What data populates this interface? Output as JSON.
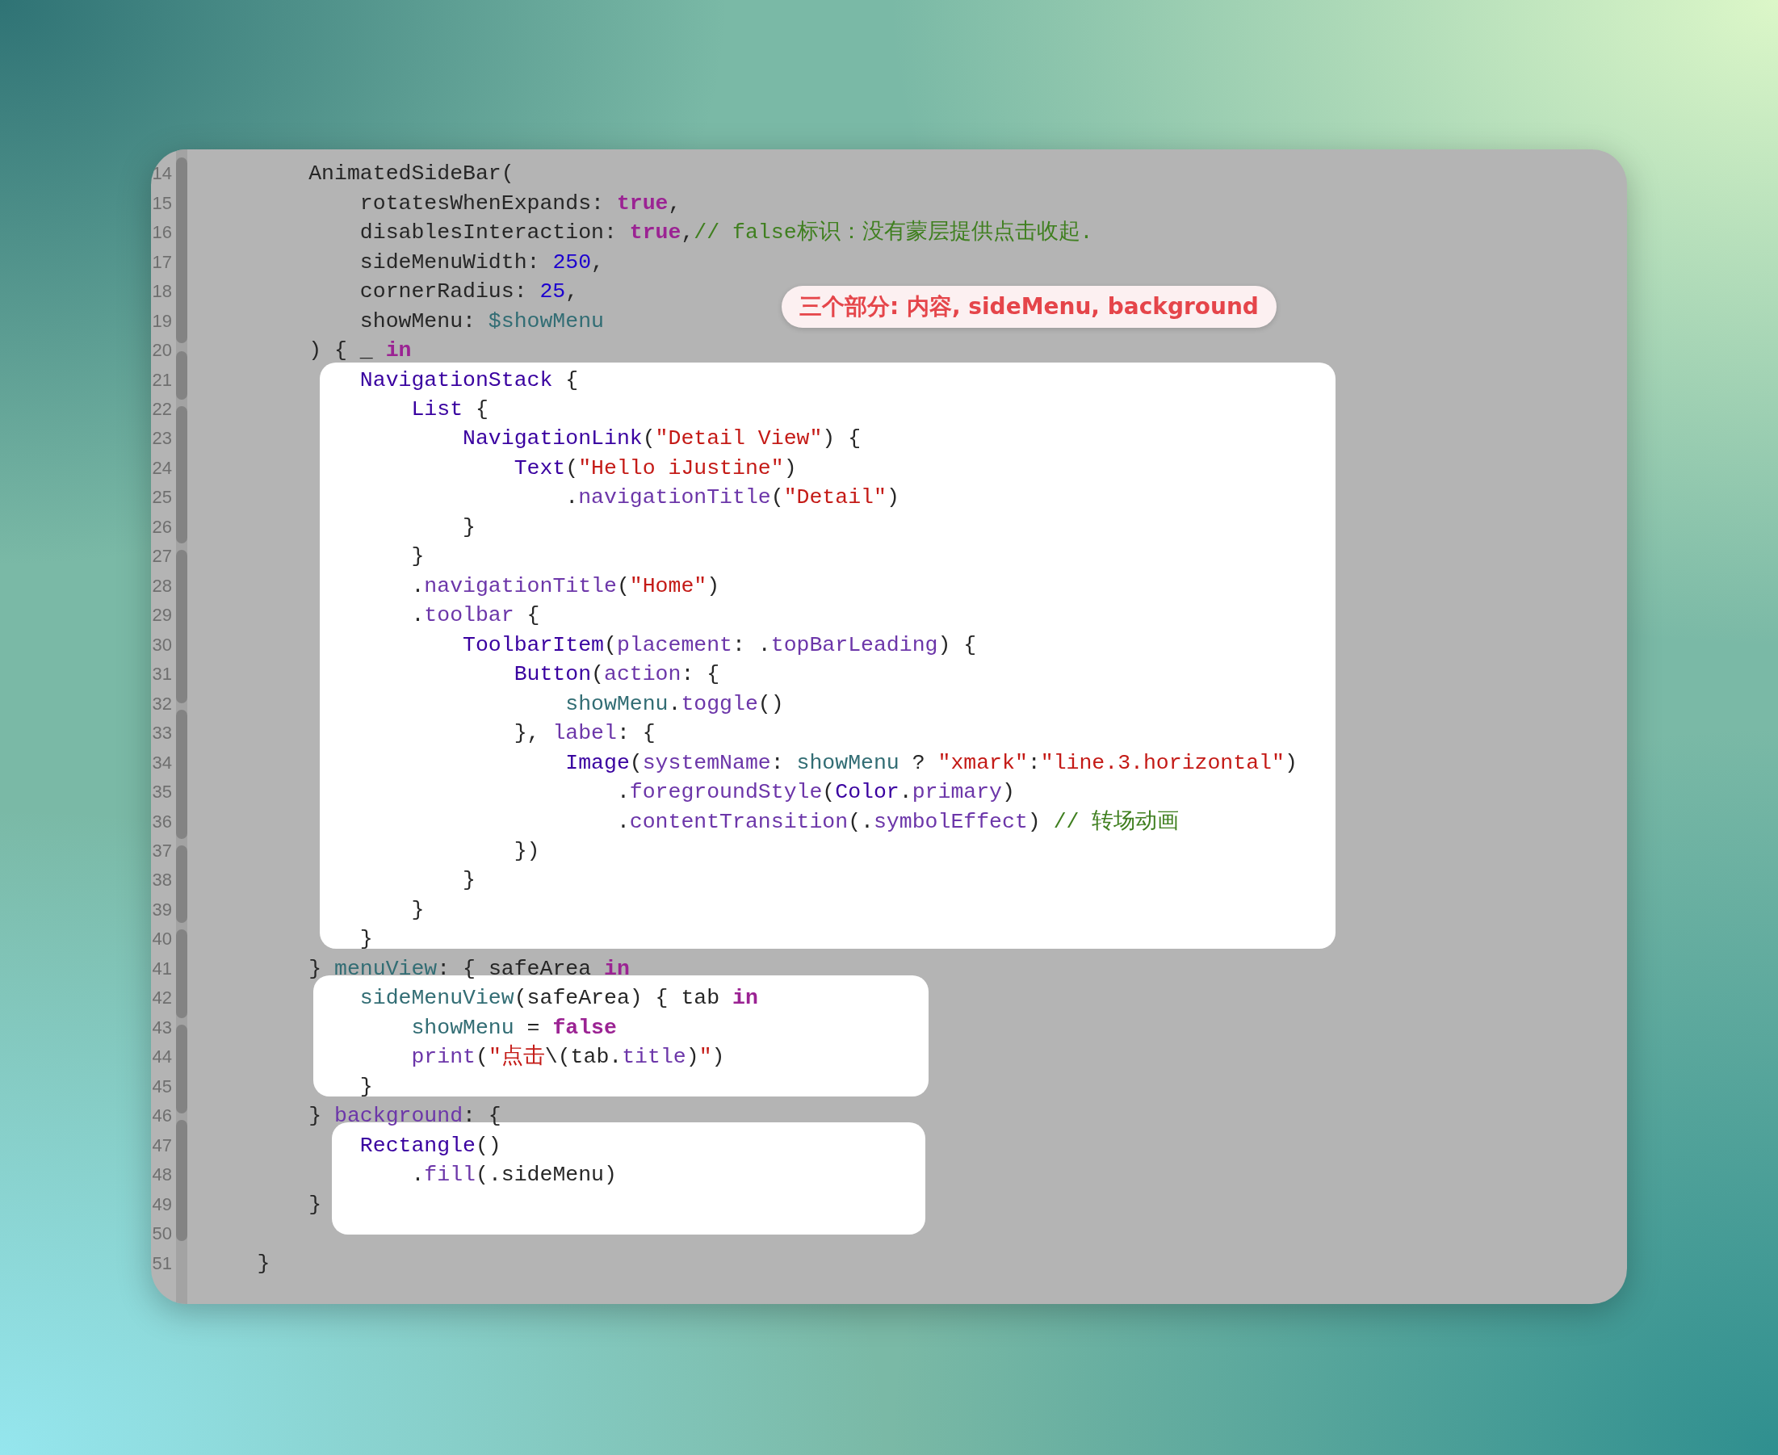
{
  "annotation": {
    "text": "三个部分: 内容, sideMenu, background"
  },
  "lines": [
    {
      "number": "14",
      "tokens": [
        {
          "kind": "plain",
          "text": "        AnimatedSideBar("
        }
      ]
    },
    {
      "number": "15",
      "tokens": [
        {
          "kind": "plain",
          "text": "            rotatesWhenExpands: "
        },
        {
          "kind": "keyword",
          "text": "true"
        },
        {
          "kind": "plain",
          "text": ","
        }
      ]
    },
    {
      "number": "16",
      "tokens": [
        {
          "kind": "plain",
          "text": "            disablesInteraction: "
        },
        {
          "kind": "keyword",
          "text": "true"
        },
        {
          "kind": "plain",
          "text": ","
        },
        {
          "kind": "comment",
          "text": "// false标识：没有蒙层提供点击收起."
        }
      ]
    },
    {
      "number": "17",
      "tokens": [
        {
          "kind": "plain",
          "text": "            sideMenuWidth: "
        },
        {
          "kind": "number",
          "text": "250"
        },
        {
          "kind": "plain",
          "text": ","
        }
      ]
    },
    {
      "number": "18",
      "tokens": [
        {
          "kind": "plain",
          "text": "            cornerRadius: "
        },
        {
          "kind": "number",
          "text": "25"
        },
        {
          "kind": "plain",
          "text": ","
        }
      ]
    },
    {
      "number": "19",
      "tokens": [
        {
          "kind": "plain",
          "text": "            showMenu: "
        },
        {
          "kind": "variable",
          "text": "$showMenu"
        }
      ]
    },
    {
      "number": "20",
      "tokens": [
        {
          "kind": "plain",
          "text": "        ) { _ "
        },
        {
          "kind": "keyword",
          "text": "in"
        }
      ]
    },
    {
      "number": "21",
      "tokens": [
        {
          "kind": "type",
          "text": "            NavigationStack"
        },
        {
          "kind": "plain",
          "text": " {"
        }
      ]
    },
    {
      "number": "22",
      "tokens": [
        {
          "kind": "type",
          "text": "                List"
        },
        {
          "kind": "plain",
          "text": " {"
        }
      ]
    },
    {
      "number": "23",
      "tokens": [
        {
          "kind": "type",
          "text": "                    NavigationLink"
        },
        {
          "kind": "plain",
          "text": "("
        },
        {
          "kind": "string",
          "text": "\"Detail View\""
        },
        {
          "kind": "plain",
          "text": ") {"
        }
      ]
    },
    {
      "number": "24",
      "tokens": [
        {
          "kind": "type",
          "text": "                        Text"
        },
        {
          "kind": "plain",
          "text": "("
        },
        {
          "kind": "string",
          "text": "\"Hello iJustine\""
        },
        {
          "kind": "plain",
          "text": ")"
        }
      ]
    },
    {
      "number": "25",
      "tokens": [
        {
          "kind": "plain",
          "text": "                            ."
        },
        {
          "kind": "method",
          "text": "navigationTitle"
        },
        {
          "kind": "plain",
          "text": "("
        },
        {
          "kind": "string",
          "text": "\"Detail\""
        },
        {
          "kind": "plain",
          "text": ")"
        }
      ]
    },
    {
      "number": "26",
      "tokens": [
        {
          "kind": "plain",
          "text": "                    }"
        }
      ]
    },
    {
      "number": "27",
      "tokens": [
        {
          "kind": "plain",
          "text": "                }"
        }
      ]
    },
    {
      "number": "28",
      "tokens": [
        {
          "kind": "plain",
          "text": "                ."
        },
        {
          "kind": "method",
          "text": "navigationTitle"
        },
        {
          "kind": "plain",
          "text": "("
        },
        {
          "kind": "string",
          "text": "\"Home\""
        },
        {
          "kind": "plain",
          "text": ")"
        }
      ]
    },
    {
      "number": "29",
      "tokens": [
        {
          "kind": "plain",
          "text": "                ."
        },
        {
          "kind": "method",
          "text": "toolbar"
        },
        {
          "kind": "plain",
          "text": " {"
        }
      ]
    },
    {
      "number": "30",
      "tokens": [
        {
          "kind": "type",
          "text": "                    ToolbarItem"
        },
        {
          "kind": "plain",
          "text": "("
        },
        {
          "kind": "method",
          "text": "placement"
        },
        {
          "kind": "plain",
          "text": ": ."
        },
        {
          "kind": "method",
          "text": "topBarLeading"
        },
        {
          "kind": "plain",
          "text": ") {"
        }
      ]
    },
    {
      "number": "31",
      "tokens": [
        {
          "kind": "type",
          "text": "                        Button"
        },
        {
          "kind": "plain",
          "text": "("
        },
        {
          "kind": "method",
          "text": "action"
        },
        {
          "kind": "plain",
          "text": ": {"
        }
      ]
    },
    {
      "number": "32",
      "tokens": [
        {
          "kind": "variable",
          "text": "                            showMenu"
        },
        {
          "kind": "plain",
          "text": "."
        },
        {
          "kind": "method",
          "text": "toggle"
        },
        {
          "kind": "plain",
          "text": "()"
        }
      ]
    },
    {
      "number": "33",
      "tokens": [
        {
          "kind": "plain",
          "text": "                        }, "
        },
        {
          "kind": "method",
          "text": "label"
        },
        {
          "kind": "plain",
          "text": ": {"
        }
      ]
    },
    {
      "number": "34",
      "tokens": [
        {
          "kind": "type",
          "text": "                            Image"
        },
        {
          "kind": "plain",
          "text": "("
        },
        {
          "kind": "method",
          "text": "systemName"
        },
        {
          "kind": "plain",
          "text": ": "
        },
        {
          "kind": "variable",
          "text": "showMenu"
        },
        {
          "kind": "plain",
          "text": " ? "
        },
        {
          "kind": "string",
          "text": "\"xmark\""
        },
        {
          "kind": "plain",
          "text": ":"
        },
        {
          "kind": "string",
          "text": "\"line.3.horizontal\""
        },
        {
          "kind": "plain",
          "text": ")"
        }
      ]
    },
    {
      "number": "35",
      "tokens": [
        {
          "kind": "plain",
          "text": "                                ."
        },
        {
          "kind": "method",
          "text": "foregroundStyle"
        },
        {
          "kind": "plain",
          "text": "("
        },
        {
          "kind": "type",
          "text": "Color"
        },
        {
          "kind": "plain",
          "text": "."
        },
        {
          "kind": "method",
          "text": "primary"
        },
        {
          "kind": "plain",
          "text": ")"
        }
      ]
    },
    {
      "number": "36",
      "tokens": [
        {
          "kind": "plain",
          "text": "                                ."
        },
        {
          "kind": "method",
          "text": "contentTransition"
        },
        {
          "kind": "plain",
          "text": "(."
        },
        {
          "kind": "method",
          "text": "symbolEffect"
        },
        {
          "kind": "plain",
          "text": ") "
        },
        {
          "kind": "comment",
          "text": "// 转场动画"
        }
      ]
    },
    {
      "number": "37",
      "tokens": [
        {
          "kind": "plain",
          "text": "                        })"
        }
      ]
    },
    {
      "number": "38",
      "tokens": [
        {
          "kind": "plain",
          "text": "                    }"
        }
      ]
    },
    {
      "number": "39",
      "tokens": [
        {
          "kind": "plain",
          "text": "                }"
        }
      ]
    },
    {
      "number": "40",
      "tokens": [
        {
          "kind": "plain",
          "text": "            }"
        }
      ]
    },
    {
      "number": "41",
      "tokens": [
        {
          "kind": "plain",
          "text": "        } "
        },
        {
          "kind": "variable",
          "text": "menuView"
        },
        {
          "kind": "plain",
          "text": ": { safeArea "
        },
        {
          "kind": "keyword",
          "text": "in"
        }
      ]
    },
    {
      "number": "42",
      "tokens": [
        {
          "kind": "variable",
          "text": "            sideMenuView"
        },
        {
          "kind": "plain",
          "text": "(safeArea) { tab "
        },
        {
          "kind": "keyword",
          "text": "in"
        }
      ]
    },
    {
      "number": "43",
      "tokens": [
        {
          "kind": "variable",
          "text": "                showMenu"
        },
        {
          "kind": "plain",
          "text": " = "
        },
        {
          "kind": "keyword",
          "text": "false"
        }
      ]
    },
    {
      "number": "44",
      "tokens": [
        {
          "kind": "method",
          "text": "                print"
        },
        {
          "kind": "plain",
          "text": "("
        },
        {
          "kind": "string",
          "text": "\"点击"
        },
        {
          "kind": "plain",
          "text": "\\(tab."
        },
        {
          "kind": "method",
          "text": "title"
        },
        {
          "kind": "plain",
          "text": ")"
        },
        {
          "kind": "string",
          "text": "\""
        },
        {
          "kind": "plain",
          "text": ")"
        }
      ]
    },
    {
      "number": "45",
      "tokens": [
        {
          "kind": "plain",
          "text": "            }"
        }
      ]
    },
    {
      "number": "46",
      "tokens": [
        {
          "kind": "plain",
          "text": "        } "
        },
        {
          "kind": "method",
          "text": "background"
        },
        {
          "kind": "plain",
          "text": ": {"
        }
      ]
    },
    {
      "number": "47",
      "tokens": [
        {
          "kind": "type",
          "text": "            Rectangle"
        },
        {
          "kind": "plain",
          "text": "()"
        }
      ]
    },
    {
      "number": "48",
      "tokens": [
        {
          "kind": "plain",
          "text": "                ."
        },
        {
          "kind": "method",
          "text": "fill"
        },
        {
          "kind": "plain",
          "text": "(.sideMenu)"
        }
      ]
    },
    {
      "number": "49",
      "tokens": [
        {
          "kind": "plain",
          "text": "        }"
        }
      ]
    },
    {
      "number": "50"
    },
    {
      "number": "51",
      "tokens": [
        {
          "kind": "plain",
          "text": "    }"
        }
      ]
    }
  ]
}
